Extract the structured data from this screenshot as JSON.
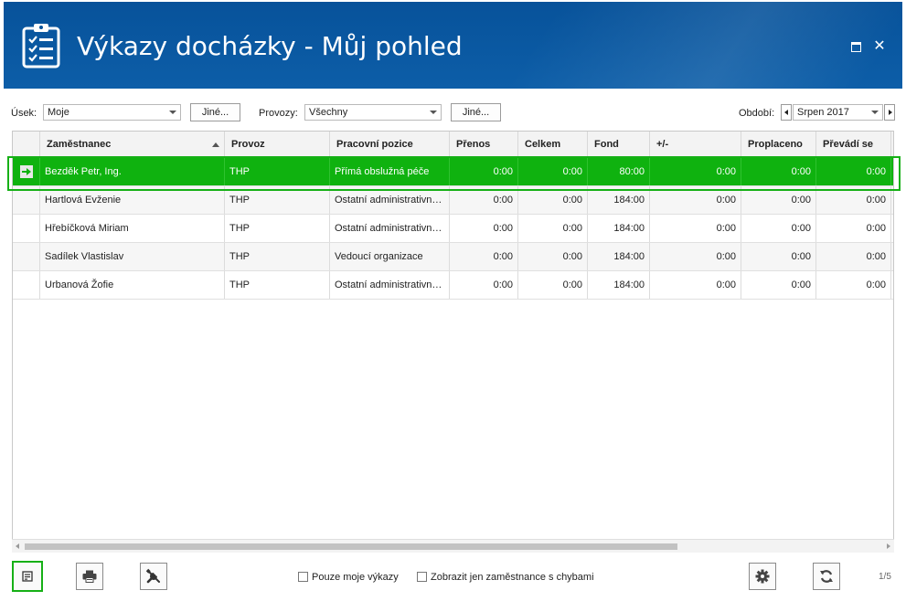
{
  "window": {
    "title": "Výkazy docházky - Můj pohled"
  },
  "filters": {
    "usek_label": "Úsek:",
    "usek_value": "Moje",
    "usek_other": "Jiné...",
    "provozy_label": "Provozy:",
    "provozy_value": "Všechny",
    "provozy_other": "Jiné...",
    "obdobi_label": "Období:",
    "obdobi_value": "Srpen 2017"
  },
  "grid": {
    "columns": [
      "Zaměstnanec",
      "Provoz",
      "Pracovní pozice",
      "Přenos",
      "Celkem",
      "Fond",
      "+/-",
      "Proplaceno",
      "Převádí se"
    ],
    "rows": [
      [
        "Bezděk Petr, Ing.",
        "THP",
        "Přímá obslužná péče",
        "0:00",
        "0:00",
        "80:00",
        "0:00",
        "0:00",
        "0:00"
      ],
      [
        "Hartlová Evženie",
        "THP",
        "Ostatní administrativní pracovník",
        "0:00",
        "0:00",
        "184:00",
        "0:00",
        "0:00",
        "0:00"
      ],
      [
        "Hřebíčková Miriam",
        "THP",
        "Ostatní administrativní pracovník",
        "0:00",
        "0:00",
        "184:00",
        "0:00",
        "0:00",
        "0:00"
      ],
      [
        "Sadílek Vlastislav",
        "THP",
        "Vedoucí organizace",
        "0:00",
        "0:00",
        "184:00",
        "0:00",
        "0:00",
        "0:00"
      ],
      [
        "Urbanová Žofie",
        "THP",
        "Ostatní administrativní pracovník",
        "0:00",
        "0:00",
        "184:00",
        "0:00",
        "0:00",
        "0:00"
      ]
    ],
    "selected_row": 0
  },
  "footer": {
    "only_mine_label": "Pouze moje výkazy",
    "only_errors_label": "Zobrazit jen zaměstnance s chybami",
    "page_info": "1/5"
  },
  "colors": {
    "titlebar": "#07529a",
    "selection": "#0fb20f"
  }
}
